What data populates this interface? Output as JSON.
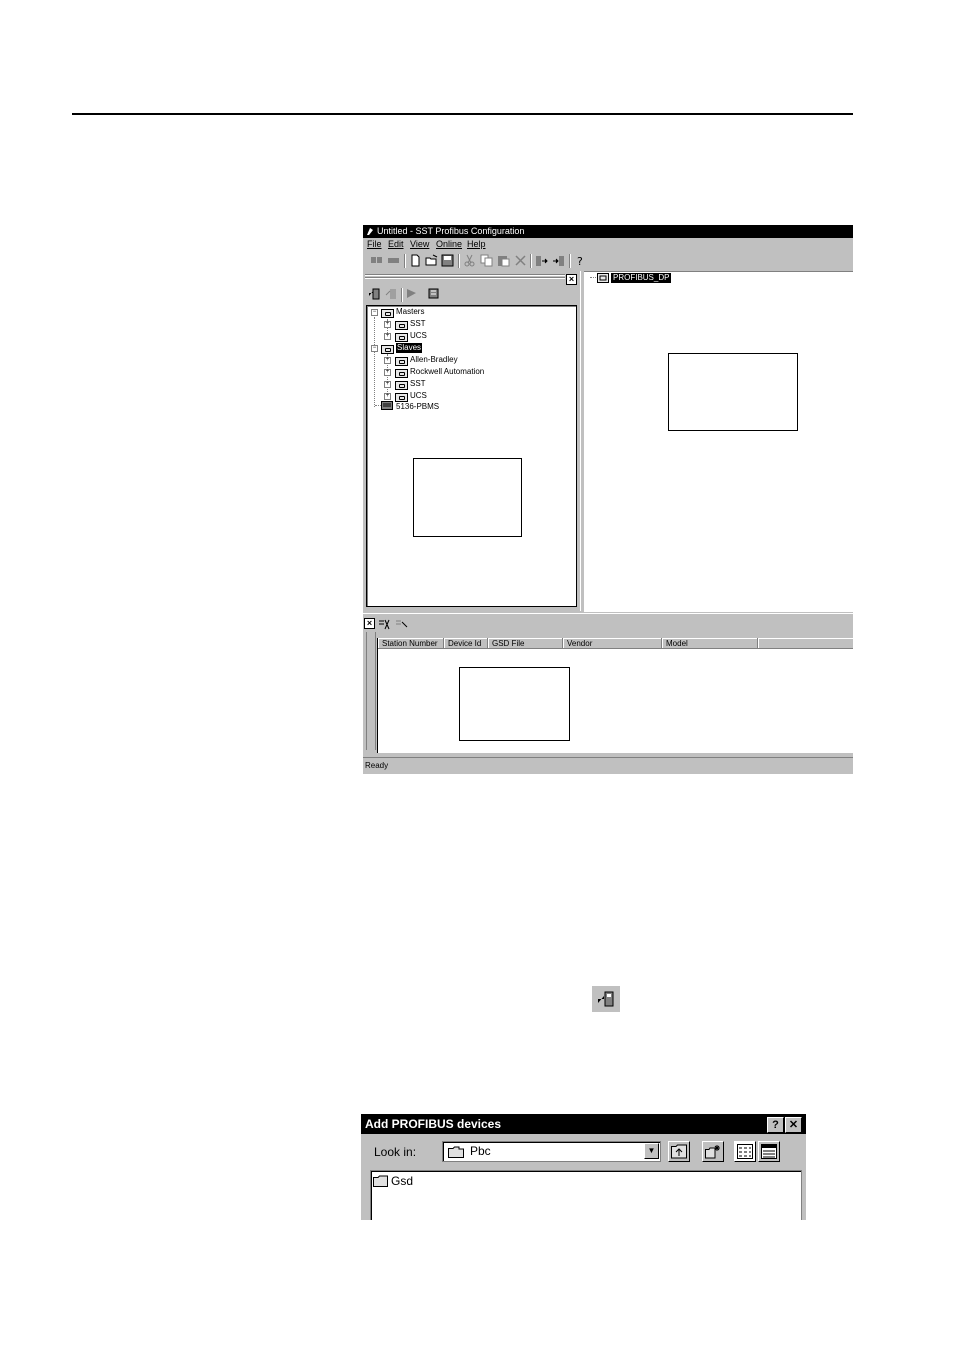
{
  "app": {
    "title": "Untitled - SST Profibus Configuration",
    "menu": [
      "File",
      "Edit",
      "View",
      "Online",
      "Help"
    ],
    "tree": {
      "masters": "Masters",
      "masters_children": [
        "SST",
        "UCS"
      ],
      "slaves": "Slaves",
      "slaves_children": [
        "Allen-Bradley",
        "Rockwell Automation",
        "SST",
        "UCS"
      ],
      "device": "5136-PBMS"
    },
    "network_root": "PROFIBUS_DP",
    "columns": [
      "Station Number",
      "Device Id",
      "GSD File",
      "Vendor",
      "Model"
    ],
    "status": "Ready"
  },
  "dialog": {
    "title": "Add PROFIBUS devices",
    "help_button": "?",
    "close_button": "✕",
    "look_in_label": "Look in:",
    "look_in_value": "Pbc",
    "files": [
      "Gsd"
    ]
  },
  "icons": [
    "app-icon",
    "new-icon",
    "open-icon",
    "save-icon",
    "cut-icon",
    "copy-icon",
    "paste-icon",
    "delete-icon",
    "help-icon",
    "add-device-icon",
    "folder-icon"
  ]
}
